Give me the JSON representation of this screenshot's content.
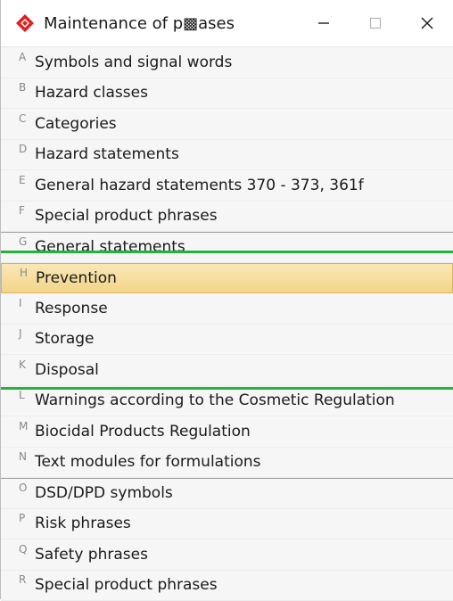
{
  "window": {
    "title": "Maintenance of p▩ases",
    "minimize_icon": "minimize-icon",
    "maximize_icon": "maximize-icon",
    "close_icon": "close-icon",
    "app_icon_color": "#e02020"
  },
  "items": [
    {
      "letter": "A",
      "label": "Symbols and signal words"
    },
    {
      "letter": "B",
      "label": "Hazard classes"
    },
    {
      "letter": "C",
      "label": "Categories"
    },
    {
      "letter": "D",
      "label": "Hazard statements"
    },
    {
      "letter": "E",
      "label": "General hazard statements 370 - 373, 361f"
    },
    {
      "letter": "F",
      "label": "Special product phrases"
    },
    {
      "letter": "G",
      "label": "General statements"
    },
    {
      "letter": "H",
      "label": "Prevention",
      "selected": true
    },
    {
      "letter": "I",
      "label": "Response"
    },
    {
      "letter": "J",
      "label": "Storage"
    },
    {
      "letter": "K",
      "label": "Disposal"
    },
    {
      "letter": "L",
      "label": "Warnings according to the Cosmetic Regulation"
    },
    {
      "letter": "M",
      "label": "Biocidal Products Regulation"
    },
    {
      "letter": "N",
      "label": "Text modules for formulations"
    },
    {
      "letter": "O",
      "label": "DSD/DPD symbols"
    },
    {
      "letter": "P",
      "label": "Risk phrases"
    },
    {
      "letter": "Q",
      "label": "Safety phrases"
    },
    {
      "letter": "R",
      "label": "Special product phrases"
    }
  ],
  "colors": {
    "highlight_box": "#22b33a",
    "selected_fill": "#f2d58a",
    "accent_blue": "#3fb3e0"
  }
}
